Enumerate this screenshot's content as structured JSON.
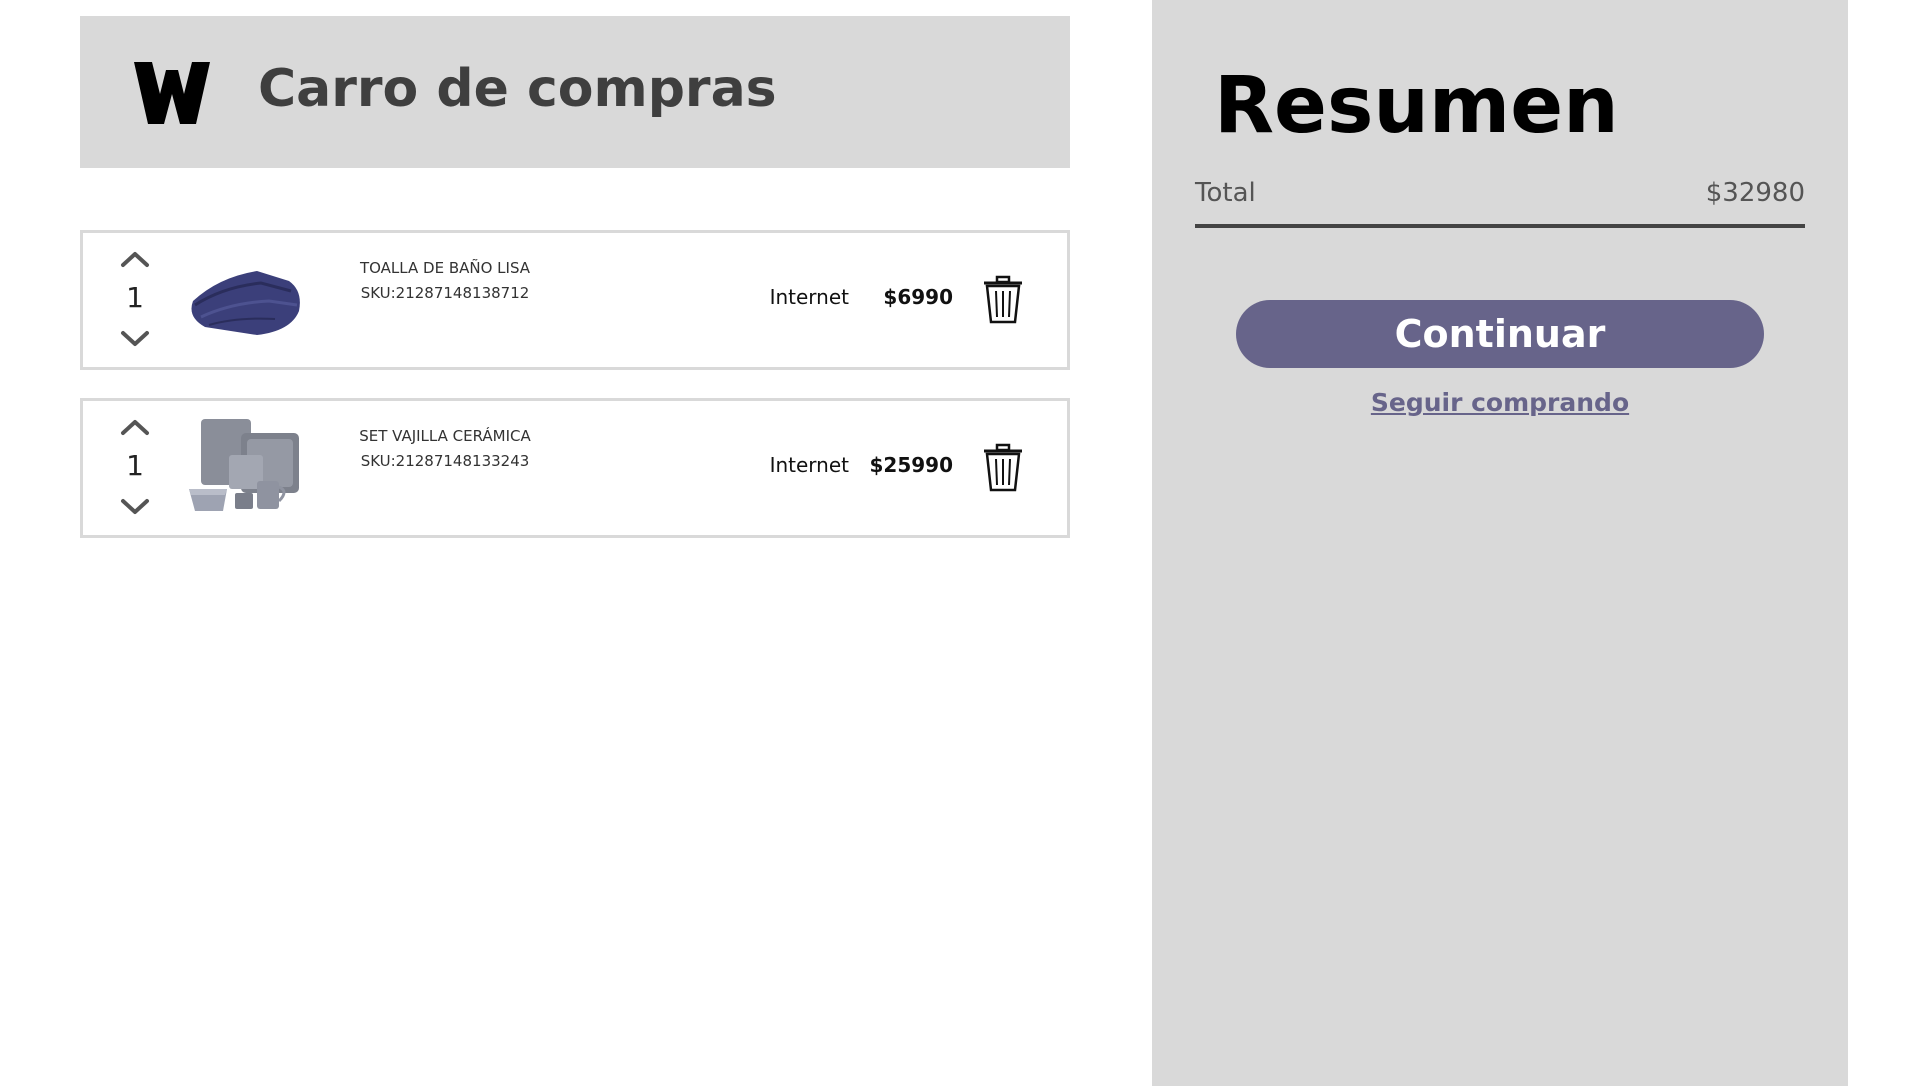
{
  "header": {
    "logo_icon": "w-logo-icon",
    "title": "Carro de compras"
  },
  "cart": {
    "items": [
      {
        "name": "TOALLA DE BAÑO LISA",
        "sku": "SKU:21287148138712",
        "quantity": "1",
        "channel": "Internet",
        "price": "$6990",
        "image_icon": "folded-towel-image"
      },
      {
        "name": "SET VAJILLA CERÁMICA",
        "sku": "SKU:21287148133243",
        "quantity": "1",
        "channel": "Internet",
        "price": "$25990",
        "image_icon": "ceramic-dish-set-image"
      }
    ]
  },
  "summary": {
    "title": "Resumen",
    "total_label": "Total",
    "total_value": "$32980",
    "continue_label": "Continuar",
    "keep_shopping_label": "Seguir comprando"
  },
  "colors": {
    "panel": "#d9d9d9",
    "accent": "#67648a",
    "header_text": "#3f3f3f"
  }
}
